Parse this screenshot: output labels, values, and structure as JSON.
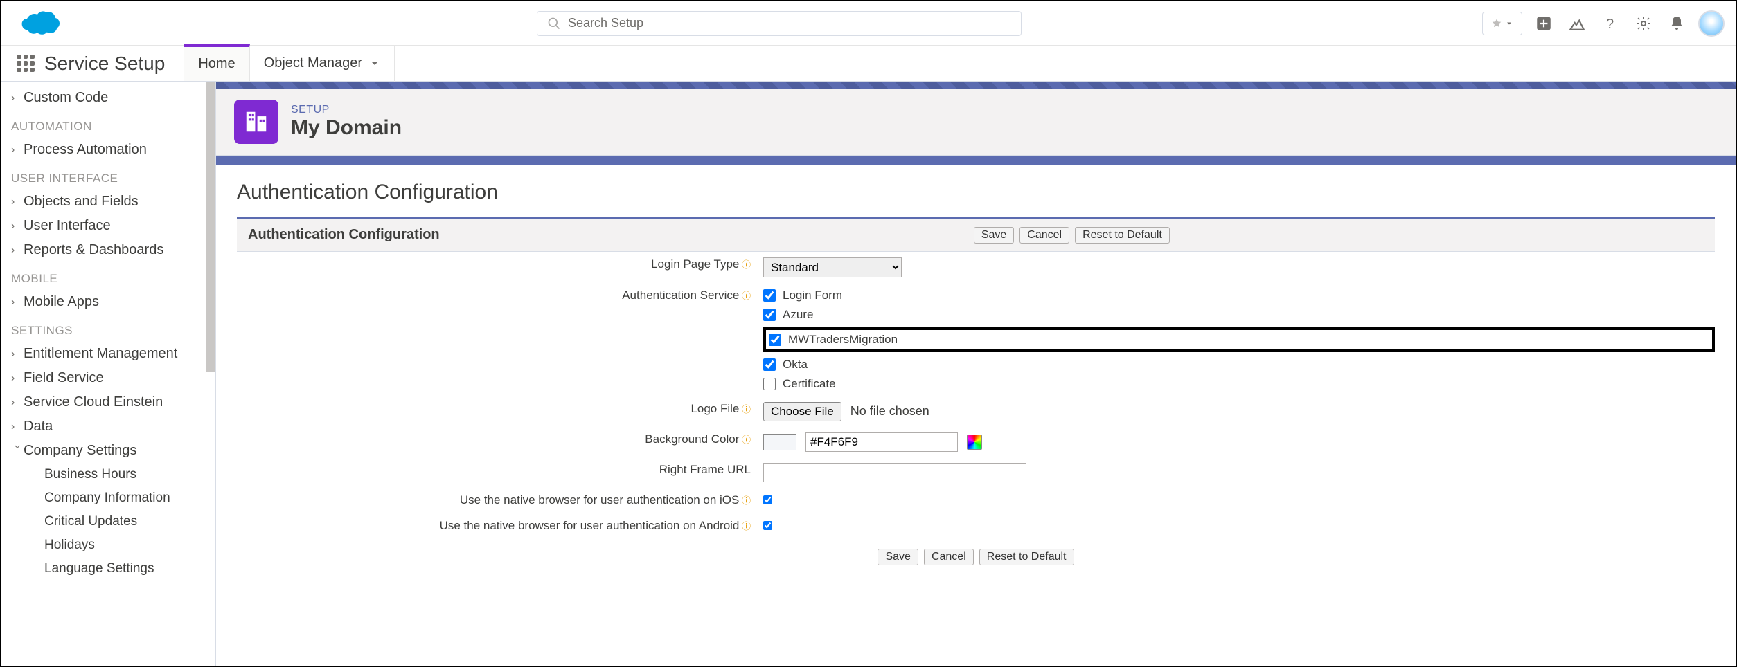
{
  "topbar": {
    "search_placeholder": "Search Setup"
  },
  "navbar": {
    "app_name": "Service Setup",
    "tab_home": "Home",
    "tab_object_manager": "Object Manager"
  },
  "sidebar": {
    "custom_code": "Custom Code",
    "head_automation": "AUTOMATION",
    "process_automation": "Process Automation",
    "head_ui": "USER INTERFACE",
    "objects_fields": "Objects and Fields",
    "user_interface": "User Interface",
    "reports_dash": "Reports & Dashboards",
    "head_mobile": "MOBILE",
    "mobile_apps": "Mobile Apps",
    "head_settings": "SETTINGS",
    "entitlement": "Entitlement Management",
    "field_service": "Field Service",
    "einstein": "Service Cloud Einstein",
    "data": "Data",
    "company_settings": "Company Settings",
    "business_hours": "Business Hours",
    "company_info": "Company Information",
    "critical_updates": "Critical Updates",
    "holidays": "Holidays",
    "language_settings": "Language Settings"
  },
  "page": {
    "eyebrow": "SETUP",
    "title": "My Domain",
    "section_title": "Authentication Configuration",
    "panel_title": "Authentication Configuration",
    "btn_save": "Save",
    "btn_cancel": "Cancel",
    "btn_reset": "Reset to Default",
    "labels": {
      "login_page_type": "Login Page Type",
      "auth_service": "Authentication Service",
      "logo_file": "Logo File",
      "bg_color": "Background Color",
      "right_frame_url": "Right Frame URL",
      "native_ios": "Use the native browser for user authentication on iOS",
      "native_android": "Use the native browser for user authentication on Android"
    },
    "login_type_value": "Standard",
    "auth_services": {
      "login_form": "Login Form",
      "azure": "Azure",
      "mwtraders": "MWTradersMigration",
      "okta": "Okta",
      "certificate": "Certificate"
    },
    "choose_file": "Choose File",
    "no_file": "No file chosen",
    "bg_color_value": "#F4F6F9"
  }
}
